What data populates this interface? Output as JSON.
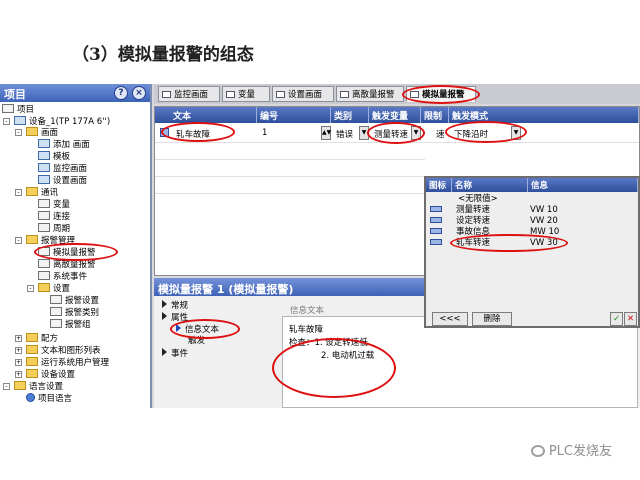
{
  "heading": "（3）模拟量报警的组态",
  "tree": {
    "title": "项目",
    "buttons": [
      "?",
      "×"
    ],
    "nodes": [
      "项目",
      "设备_1(TP 177A 6'')",
      "画面",
      "添加 画面",
      "模板",
      "监控画面",
      "设置画面",
      "通讯",
      "变量",
      "连接",
      "周期",
      "报警管理",
      "模拟量报警",
      "离散量报警",
      "系统事件",
      "设置",
      "报警设置",
      "报警类别",
      "报警组",
      "配方",
      "文本和图形列表",
      "运行系统用户管理",
      "设备设置",
      "语言设置",
      "项目语言"
    ]
  },
  "tabs": [
    "监控画面",
    "变量",
    "设置画面",
    "离散量报警",
    "模拟量报警"
  ],
  "grid": {
    "columns": [
      "文本",
      "编号",
      "类别",
      "触发变量",
      "限制",
      "触发模式"
    ],
    "row": {
      "text": "轧车故障",
      "number": "1",
      "category": "错误",
      "trigger_tag": "测量转速",
      "limit": "速",
      "trigger_mode": "下降沿时"
    }
  },
  "popup": {
    "columns": [
      "图标",
      "名称",
      "信息"
    ],
    "rows": [
      {
        "name": "<无限值>",
        "info": ""
      },
      {
        "name": "测量转速",
        "info": "VW 10"
      },
      {
        "name": "设定转速",
        "info": "VW 20"
      },
      {
        "name": "事故信息",
        "info": "MW 10"
      },
      {
        "name": "轧车转速",
        "info": "VW 30"
      }
    ],
    "back_button": "<<<",
    "clear_button": "删除"
  },
  "props": {
    "title": "模拟量报警 1 (模拟量报警)",
    "tree": [
      "常规",
      "属性",
      "信息文本",
      "触发",
      "事件"
    ],
    "info_label": "信息文本",
    "info_lines": [
      "轧车故障",
      "检查：1.  设定转速低",
      "2.  电动机过载"
    ]
  },
  "watermark": "PLC发烧友",
  "colors": {
    "title_bar": "#3d63b9",
    "header": "#2e4f9b",
    "annotation": "#dd1111",
    "ok": "#2a8a2a",
    "cancel": "#cc1111"
  }
}
